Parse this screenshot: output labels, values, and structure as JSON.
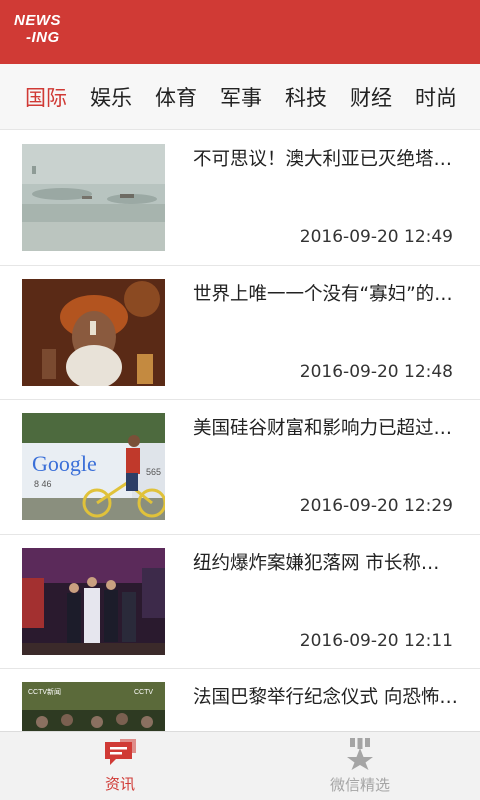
{
  "header": {
    "logo_line1": "NEWS",
    "logo_line2": "-ING",
    "brand_color": "#d03a35"
  },
  "tabs": [
    {
      "label": "国际",
      "active": true
    },
    {
      "label": "娱乐",
      "active": false
    },
    {
      "label": "体育",
      "active": false
    },
    {
      "label": "军事",
      "active": false
    },
    {
      "label": "科技",
      "active": false
    },
    {
      "label": "财经",
      "active": false
    },
    {
      "label": "时尚",
      "active": false
    }
  ],
  "news": [
    {
      "title": "不可思议！澳大利亚已灭绝塔斯马尼亚虎",
      "time": "2016-09-20 12:49",
      "thumb_icon": "wildlife-photo"
    },
    {
      "title": "世界上唯一一个没有“寡妇”的国家",
      "time": "2016-09-20 12:48",
      "thumb_icon": "portrait-photo"
    },
    {
      "title": "美国硅谷财富和影响力已超过华尔街",
      "time": "2016-09-20 12:29",
      "thumb_icon": "google-bike-photo"
    },
    {
      "title": "纽约爆炸案嫌犯落网 市长称…",
      "time": "2016-09-20 12:11",
      "thumb_icon": "police-night-photo"
    },
    {
      "title": "法国巴黎举行纪念仪式 向恐怖袭击遇难者致哀",
      "time": "",
      "thumb_icon": "crowd-photo"
    }
  ],
  "thumb_text": {
    "google": "Google",
    "sign_left": "8 46",
    "sign_right": "565",
    "cctv1": "CCTV新闻",
    "cctv2": "CCTV"
  },
  "bottom_nav": [
    {
      "label": "资讯",
      "icon": "news-chat-icon",
      "active": true
    },
    {
      "label": "微信精选",
      "icon": "star-badge-icon",
      "active": false
    }
  ]
}
